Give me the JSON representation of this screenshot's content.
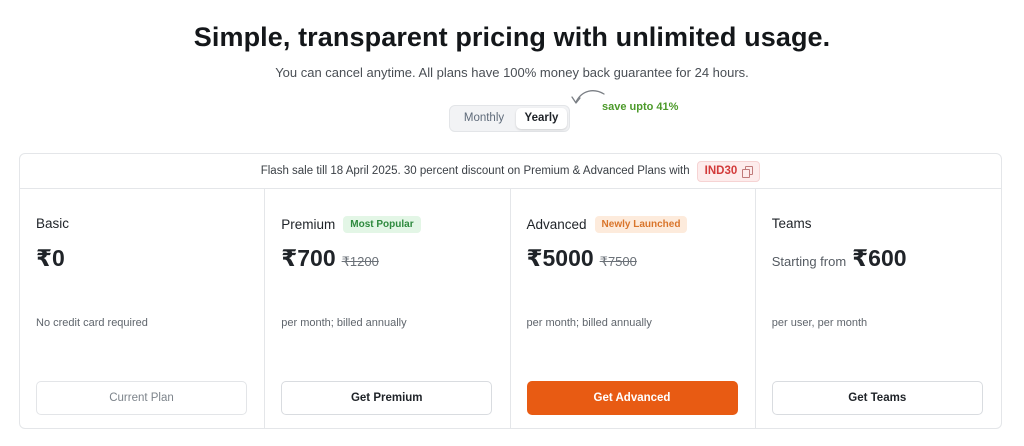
{
  "header": {
    "title": "Simple, transparent pricing with unlimited usage.",
    "subtitle": "You can cancel anytime. All plans have 100% money back guarantee for 24 hours."
  },
  "billing_toggle": {
    "monthly_label": "Monthly",
    "yearly_label": "Yearly",
    "selected": "Yearly",
    "save_note": "save upto 41%"
  },
  "banner": {
    "text": "Flash sale till 18 April 2025. 30 percent discount on Premium & Advanced Plans with",
    "coupon_code": "IND30"
  },
  "plans": [
    {
      "name": "Basic",
      "price": "₹0",
      "note": "No credit card required",
      "cta": "Current Plan"
    },
    {
      "name": "Premium",
      "badge": "Most Popular",
      "price": "₹700",
      "old_price": "₹1200",
      "note": "per month; billed annually",
      "cta": "Get Premium"
    },
    {
      "name": "Advanced",
      "badge": "Newly Launched",
      "price": "₹5000",
      "old_price": "₹7500",
      "note": "per month; billed annually",
      "cta": "Get Advanced"
    },
    {
      "name": "Teams",
      "price_prefix": "Starting from",
      "price": "₹600",
      "note": "per user, per month",
      "cta": "Get Teams"
    }
  ],
  "colors": {
    "accent": "#e85b13",
    "save_green": "#4c9a2a",
    "coupon_red": "#d23a3a"
  }
}
